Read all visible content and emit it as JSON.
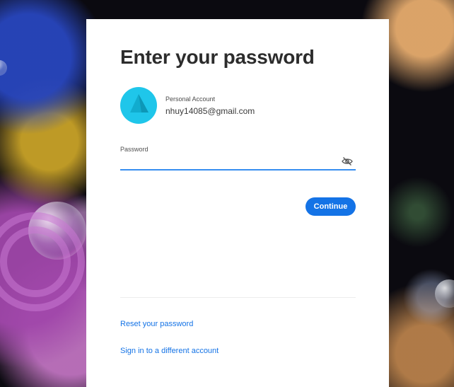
{
  "page": {
    "title": "Enter your password"
  },
  "account": {
    "type_label": "Personal Account",
    "email": "nhuy14085@gmail.com",
    "avatar_color": "#1fc6ea"
  },
  "password": {
    "label": "Password",
    "value": "",
    "visibility_icon": "eye-slash-icon"
  },
  "actions": {
    "continue_label": "Continue",
    "primary_color": "#1473e6"
  },
  "links": {
    "reset_password": "Reset your password",
    "different_account": "Sign in to a different account"
  }
}
